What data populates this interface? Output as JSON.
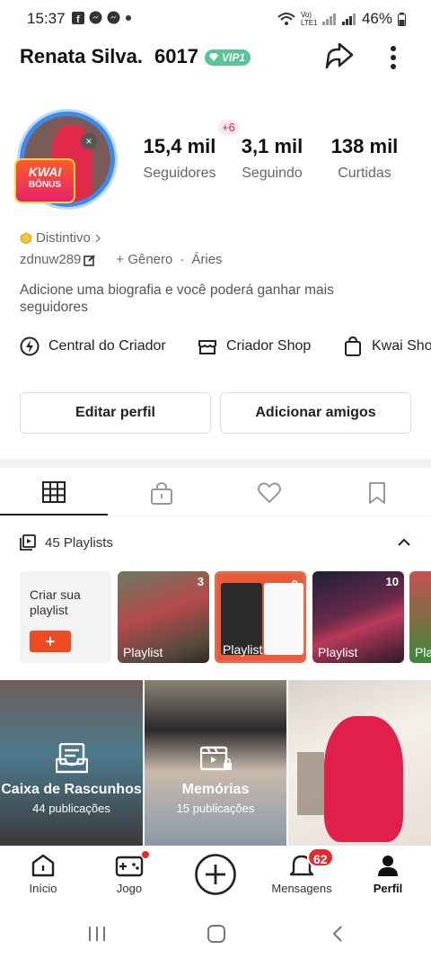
{
  "status_bar": {
    "time": "15:37",
    "network": "Vo) LTE1",
    "battery": "46%"
  },
  "profile": {
    "name": "Renata Silva.",
    "user_number": "6017",
    "vip_label": "VIP1",
    "avatar_badge_line1": "KWAI",
    "avatar_badge_line2": "BÔNUS",
    "new_followers": "+6"
  },
  "stats": [
    {
      "value": "15,4 mil",
      "label": "Seguidores"
    },
    {
      "value": "3,1 mil",
      "label": "Seguindo"
    },
    {
      "value": "138 mil",
      "label": "Curtidas"
    }
  ],
  "badge_link": "Distintivo",
  "username": "zdnuw289",
  "gender_label": "+ Gênero",
  "zodiac": "Áries",
  "bio_prompt": "Adicione uma biografia e você poderá ganhar mais seguidores",
  "shortcuts": [
    {
      "label": "Central do Criador",
      "icon": "lightning-circle-icon"
    },
    {
      "label": "Criador Shop",
      "icon": "shop-icon"
    },
    {
      "label": "Kwai Sho",
      "icon": "shopping-bag-icon"
    }
  ],
  "buttons": {
    "edit_profile": "Editar perfil",
    "add_friends": "Adicionar amigos"
  },
  "playlists": {
    "label": "45 Playlists",
    "create_label": "Criar sua playlist",
    "create_plus": "+",
    "cards": [
      {
        "count": "3",
        "label": "Playlist"
      },
      {
        "count": "2",
        "label": "Playlist"
      },
      {
        "count": "10",
        "label": "Playlist"
      },
      {
        "count": "",
        "label": "Pla"
      }
    ]
  },
  "grid": [
    {
      "title": "Caixa de Rascunhos",
      "subtitle": "44 publicações"
    },
    {
      "title": "Memórias",
      "subtitle": "15 publicações"
    }
  ],
  "bottom_nav": {
    "home": "Início",
    "game": "Jogo",
    "messages": "Mensagens",
    "messages_badge": "62",
    "profile": "Perfil"
  },
  "colors": {
    "accent_orange": "#f04a22",
    "vip_green": "#57c596",
    "badge_red": "#e22b2b"
  }
}
